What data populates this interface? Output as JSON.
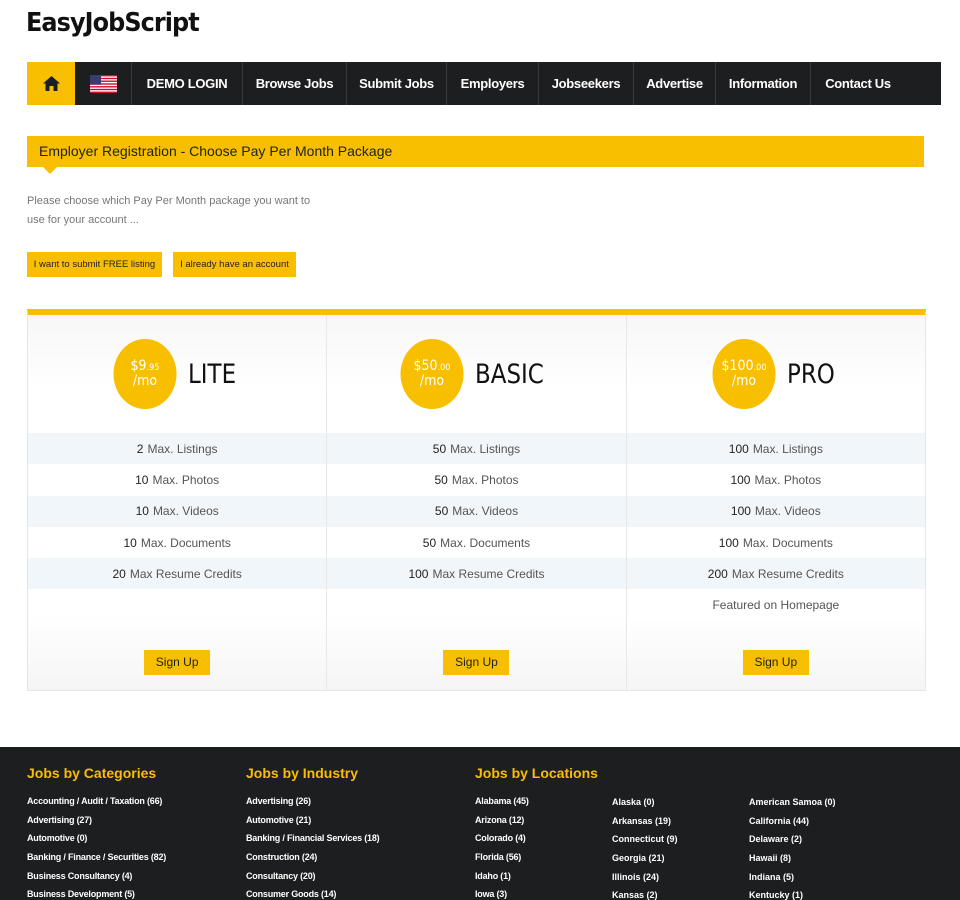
{
  "header": {
    "logo": "EasyJobScript"
  },
  "nav": {
    "items": [
      "DEMO LOGIN",
      "Browse Jobs",
      "Submit Jobs",
      "Employers",
      "Jobseekers",
      "Advertise",
      "Information",
      "Contact Us"
    ]
  },
  "registration": {
    "title": "Employer Registration - Choose Pay Per Month Package",
    "intro": "Please choose which Pay Per Month package you want to use for your account ...",
    "free_button": "I want to submit FREE listing",
    "account_button": "I already have an account"
  },
  "plans": [
    {
      "dollars": "$9",
      "cents": ".95",
      "unit": "/mo",
      "name": "LITE",
      "features": [
        [
          "2",
          "Max. Listings"
        ],
        [
          "10",
          "Max. Photos"
        ],
        [
          "10",
          "Max. Videos"
        ],
        [
          "10",
          "Max. Documents"
        ],
        [
          "20",
          "Max Resume Credits"
        ]
      ],
      "signup": "Sign Up"
    },
    {
      "dollars": "$50",
      "cents": ".00",
      "unit": "/mo",
      "name": "BASIC",
      "features": [
        [
          "50",
          "Max. Listings"
        ],
        [
          "50",
          "Max. Photos"
        ],
        [
          "50",
          "Max. Videos"
        ],
        [
          "50",
          "Max. Documents"
        ],
        [
          "100",
          "Max Resume Credits"
        ]
      ],
      "signup": "Sign Up"
    },
    {
      "dollars": "$100",
      "cents": ".00",
      "unit": "/mo",
      "name": "PRO",
      "features": [
        [
          "100",
          "Max. Listings"
        ],
        [
          "100",
          "Max. Photos"
        ],
        [
          "100",
          "Max. Videos"
        ],
        [
          "100",
          "Max. Documents"
        ],
        [
          "200",
          "Max Resume Credits"
        ],
        [
          "",
          "Featured on Homepage"
        ]
      ],
      "signup": "Sign Up"
    }
  ],
  "footer": {
    "categories": {
      "title": "Jobs by Categories",
      "items": [
        "Accounting / Audit / Taxation (66)",
        "Advertising (27)",
        "Automotive (0)",
        "Banking / Finance / Securities (82)",
        "Business Consultancy (4)",
        "Business Development (5)"
      ]
    },
    "industry": {
      "title": "Jobs by Industry",
      "items": [
        "Advertising (26)",
        "Automotive (21)",
        "Banking / Financial Services (18)",
        "Construction (24)",
        "Consultancy (20)",
        "Consumer Goods (14)"
      ]
    },
    "locations": {
      "title": "Jobs by Locations",
      "col1": [
        "Alabama (45)",
        "Arizona (12)",
        "Colorado (4)",
        "Florida (56)",
        "Idaho (1)",
        "Iowa (3)"
      ],
      "col2": [
        "Alaska (0)",
        "Arkansas (19)",
        "Connecticut (9)",
        "Georgia (21)",
        "Illinois (24)",
        "Kansas (2)"
      ],
      "col3": [
        "American Samoa (0)",
        "California (44)",
        "Delaware (2)",
        "Hawaii (8)",
        "Indiana (5)",
        "Kentucky (1)"
      ]
    }
  },
  "colors": {
    "accent": "#f8bf00",
    "nav_bg": "#1d1e20"
  },
  "icons": {
    "home": "home-icon",
    "flag": "us-flag-icon"
  }
}
